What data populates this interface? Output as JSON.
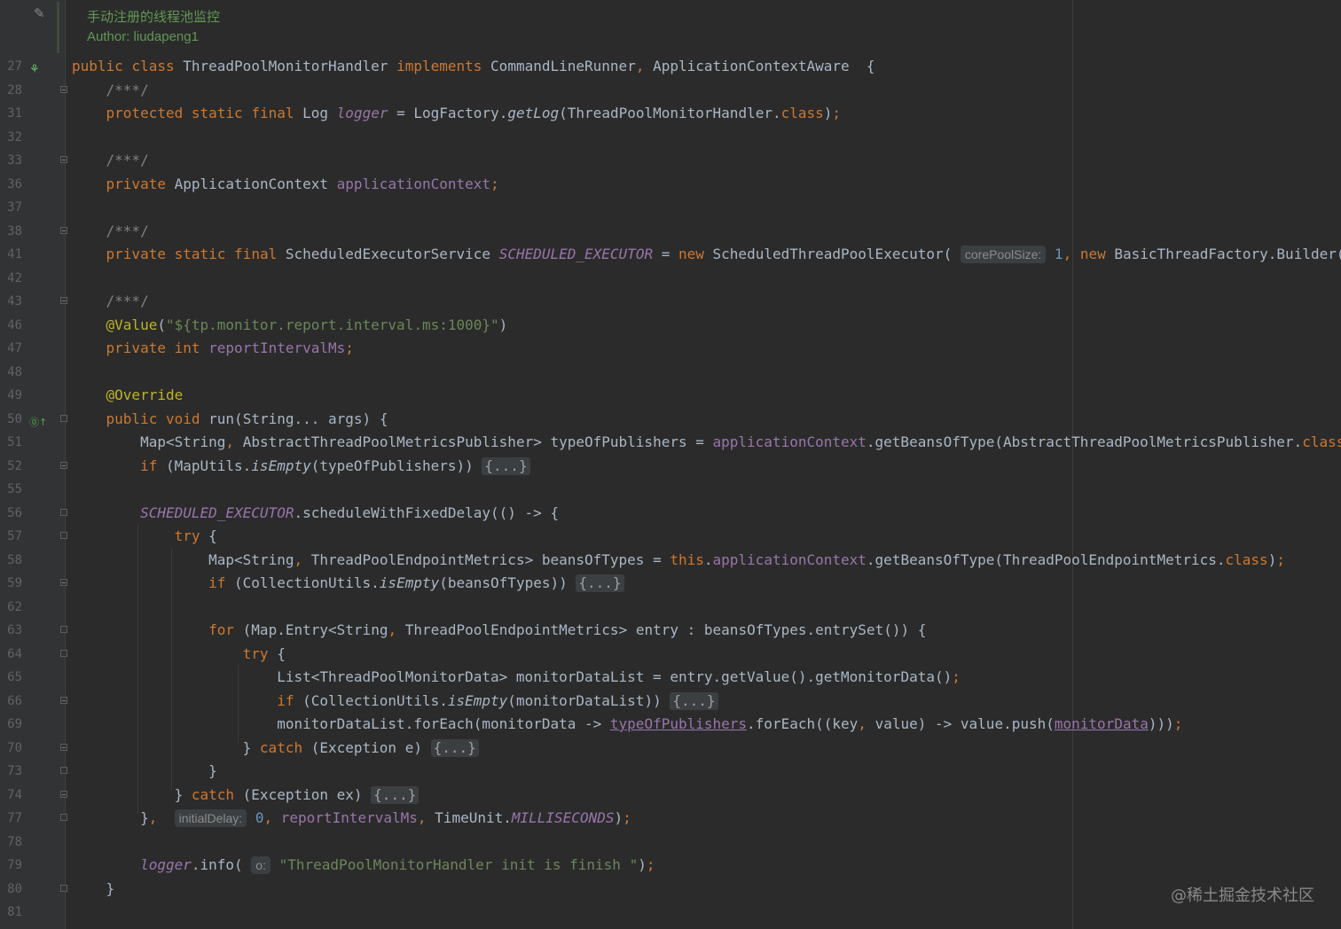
{
  "doc_comment": {
    "title": "手动注册的线程池监控",
    "author": "Author: liudapeng1"
  },
  "watermark": "@稀土掘金技术社区",
  "lines": [
    {
      "ln": "27",
      "text": "public class ThreadPoolMonitorHandler implements CommandLineRunner, ApplicationContextAware  {"
    },
    {
      "ln": "28",
      "text": "    /***/"
    },
    {
      "ln": "31",
      "text": "    protected static final Log logger = LogFactory.getLog(ThreadPoolMonitorHandler.class);"
    },
    {
      "ln": "32",
      "text": ""
    },
    {
      "ln": "33",
      "text": "    /***/"
    },
    {
      "ln": "36",
      "text": "    private ApplicationContext applicationContext;"
    },
    {
      "ln": "37",
      "text": ""
    },
    {
      "ln": "38",
      "text": "    /***/"
    },
    {
      "ln": "41",
      "text": "    private static final ScheduledExecutorService SCHEDULED_EXECUTOR = new ScheduledThreadPoolExecutor( corePoolSize: 1, new BasicThreadFactory.Builder().na"
    },
    {
      "ln": "42",
      "text": ""
    },
    {
      "ln": "43",
      "text": "    /***/"
    },
    {
      "ln": "46",
      "text": "    @Value(\"${tp.monitor.report.interval.ms:1000}\")"
    },
    {
      "ln": "47",
      "text": "    private int reportIntervalMs;"
    },
    {
      "ln": "48",
      "text": ""
    },
    {
      "ln": "49",
      "text": "    @Override"
    },
    {
      "ln": "50",
      "text": "    public void run(String... args) {"
    },
    {
      "ln": "51",
      "text": "        Map<String, AbstractThreadPoolMetricsPublisher> typeOfPublishers = applicationContext.getBeansOfType(AbstractThreadPoolMetricsPublisher.class);"
    },
    {
      "ln": "52",
      "text": "        if (MapUtils.isEmpty(typeOfPublishers)) {...}"
    },
    {
      "ln": "55",
      "text": ""
    },
    {
      "ln": "56",
      "text": "        SCHEDULED_EXECUTOR.scheduleWithFixedDelay(() -> {"
    },
    {
      "ln": "57",
      "text": "            try {"
    },
    {
      "ln": "58",
      "text": "                Map<String, ThreadPoolEndpointMetrics> beansOfTypes = this.applicationContext.getBeansOfType(ThreadPoolEndpointMetrics.class);"
    },
    {
      "ln": "59",
      "text": "                if (CollectionUtils.isEmpty(beansOfTypes)) {...}"
    },
    {
      "ln": "62",
      "text": ""
    },
    {
      "ln": "63",
      "text": "                for (Map.Entry<String, ThreadPoolEndpointMetrics> entry : beansOfTypes.entrySet()) {"
    },
    {
      "ln": "64",
      "text": "                    try {"
    },
    {
      "ln": "65",
      "text": "                        List<ThreadPoolMonitorData> monitorDataList = entry.getValue().getMonitorData();"
    },
    {
      "ln": "66",
      "text": "                        if (CollectionUtils.isEmpty(monitorDataList)) {...}"
    },
    {
      "ln": "69",
      "text": "                        monitorDataList.forEach(monitorData -> typeOfPublishers.forEach((key, value) -> value.push(monitorData)));"
    },
    {
      "ln": "70",
      "text": "                    } catch (Exception e) {...}"
    },
    {
      "ln": "73",
      "text": "                }"
    },
    {
      "ln": "74",
      "text": "            } catch (Exception ex) {...}"
    },
    {
      "ln": "77",
      "text": "        },  initialDelay: 0, reportIntervalMs, TimeUnit.MILLISECONDS);"
    },
    {
      "ln": "78",
      "text": ""
    },
    {
      "ln": "79",
      "text": "        logger.info( o: \"ThreadPoolMonitorHandler init is finish \");"
    },
    {
      "ln": "80",
      "text": "    }"
    },
    {
      "ln": "81",
      "text": ""
    }
  ],
  "hints": {
    "core_pool_size": "corePoolSize:",
    "initial_delay": "initialDelay:",
    "o": "o:"
  },
  "colors": {
    "background": "#2b2b2b",
    "keyword": "#cc7832",
    "field": "#9876aa",
    "string": "#6a8759",
    "number": "#6897bb",
    "annotation": "#bbb529",
    "doc": "#629755"
  }
}
